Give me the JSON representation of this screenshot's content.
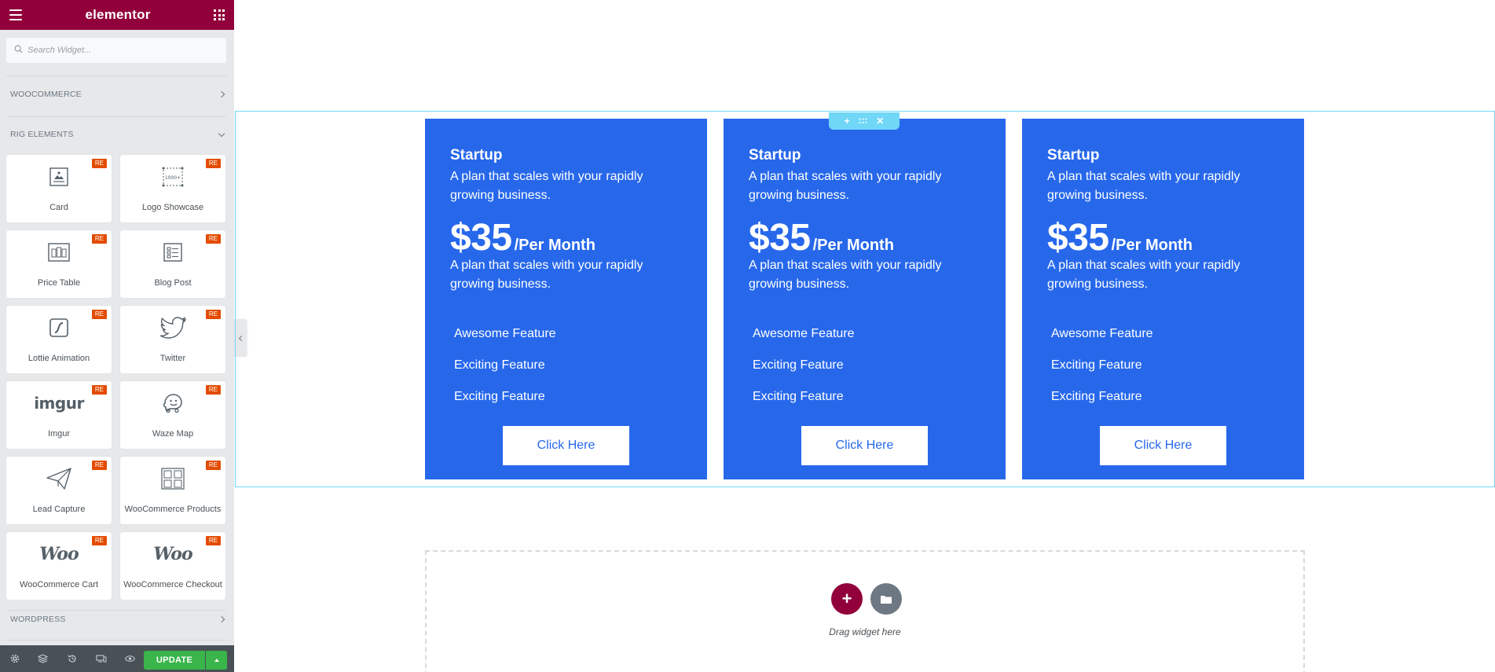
{
  "panel": {
    "logo": "elementor",
    "search_placeholder": "Search Widget...",
    "categories": {
      "woocommerce": "WOOCOMMERCE",
      "rig_elements": "RIG ELEMENTS",
      "wordpress": "WORDPRESS"
    },
    "widgets": [
      {
        "label": "Card",
        "badge": "RE",
        "icon": "card-icon"
      },
      {
        "label": "Logo Showcase",
        "badge": "RE",
        "icon": "logo-showcase-icon"
      },
      {
        "label": "Price Table",
        "badge": "RE",
        "icon": "price-table-icon"
      },
      {
        "label": "Blog Post",
        "badge": "RE",
        "icon": "blog-post-icon"
      },
      {
        "label": "Lottie Animation",
        "badge": "RE",
        "icon": "lottie-icon"
      },
      {
        "label": "Twitter",
        "badge": "RE",
        "icon": "twitter-icon"
      },
      {
        "label": "Imgur",
        "badge": "RE",
        "icon": "imgur-logo",
        "logo_text": "imgur"
      },
      {
        "label": "Waze Map",
        "badge": "RE",
        "icon": "waze-icon"
      },
      {
        "label": "Lead Capture",
        "badge": "RE",
        "icon": "paper-plane-icon"
      },
      {
        "label": "WooCommerce Products",
        "badge": "RE",
        "icon": "woo-products-icon"
      },
      {
        "label": "WooCommerce Cart",
        "badge": "RE",
        "icon": "woo-logo",
        "logo_text": "Woo"
      },
      {
        "label": "WooCommerce Checkout",
        "badge": "RE",
        "icon": "woo-logo",
        "logo_text": "Woo"
      }
    ],
    "footer": {
      "icons": [
        "settings-icon",
        "navigator-icon",
        "history-icon",
        "responsive-icon",
        "preview-icon"
      ],
      "update_label": "UPDATE"
    }
  },
  "canvas": {
    "pricing_cards": [
      {
        "title": "Startup",
        "description": "A plan that scales with your rapidly growing business.",
        "price": "$35",
        "period": "/Per Month",
        "description2": "A plan that scales with your rapidly growing business.",
        "features": [
          "Awesome Feature",
          "Exciting Feature",
          "Exciting Feature"
        ],
        "button": "Click Here"
      },
      {
        "title": "Startup",
        "description": "A plan that scales with your rapidly growing business.",
        "price": "$35",
        "period": "/Per Month",
        "description2": "A plan that scales with your rapidly growing business.",
        "features": [
          "Awesome Feature",
          "Exciting Feature",
          "Exciting Feature"
        ],
        "button": "Click Here"
      },
      {
        "title": "Startup",
        "description": "A plan that scales with your rapidly growing business.",
        "price": "$35",
        "period": "/Per Month",
        "description2": "A plan that scales with your rapidly growing business.",
        "features": [
          "Awesome Feature",
          "Exciting Feature",
          "Exciting Feature"
        ],
        "button": "Click Here"
      }
    ],
    "drop_zone": {
      "text": "Drag widget here"
    }
  },
  "colors": {
    "brand": "#92003b",
    "card_blue": "#2768eb",
    "section_outline": "#71d7f7",
    "update_green": "#39b54a",
    "badge_orange": "#e34c00"
  }
}
